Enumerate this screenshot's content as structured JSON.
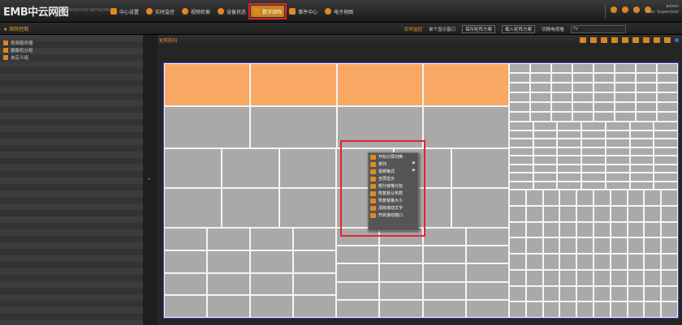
{
  "app": {
    "logo": "EMB中云网图",
    "logo_sub": "ZHONGYUN NETWORK",
    "nav": [
      {
        "label": "中心设置",
        "active": false
      },
      {
        "label": "实时监控",
        "active": false
      },
      {
        "label": "视频检索",
        "active": false
      },
      {
        "label": "设备状态",
        "active": false
      },
      {
        "label": "数字矩阵",
        "active": true
      },
      {
        "label": "事件中心",
        "active": false
      },
      {
        "label": "电子地图",
        "active": false
      }
    ],
    "user_line1": "admin",
    "user_line2": "User: Supervisor"
  },
  "subbar": {
    "title": "矩阵控制",
    "mode": "实时监控",
    "items": [
      "单个显示窗口",
      "保存矩阵方案",
      "载入矩阵方案",
      "切换电视墙"
    ],
    "select_value": "TV"
  },
  "sidebar": {
    "items": [
      {
        "label": "视频服务器"
      },
      {
        "label": "摄像机分组"
      },
      {
        "label": "自定义组"
      }
    ]
  },
  "main": {
    "title": "矩阵阵列"
  },
  "context_menu": {
    "items": [
      {
        "label": "开始分屏切换",
        "submenu": false
      },
      {
        "label": "排列",
        "submenu": true
      },
      {
        "label": "视频格式",
        "submenu": true
      },
      {
        "label": "全屏显示",
        "submenu": false
      },
      {
        "label": "部分窗格分割",
        "submenu": false
      },
      {
        "label": "恢复默认布局",
        "submenu": false
      },
      {
        "label": "恢复窗格大小",
        "submenu": false
      },
      {
        "label": "清除滚动文字",
        "submenu": false
      },
      {
        "label": "开启滚动窗口",
        "submenu": false
      }
    ]
  },
  "colors": {
    "accent": "#e8962c",
    "selected_cell": "#f9a864",
    "cell_bg": "#a9a9a9",
    "highlight": "#e1252b"
  }
}
